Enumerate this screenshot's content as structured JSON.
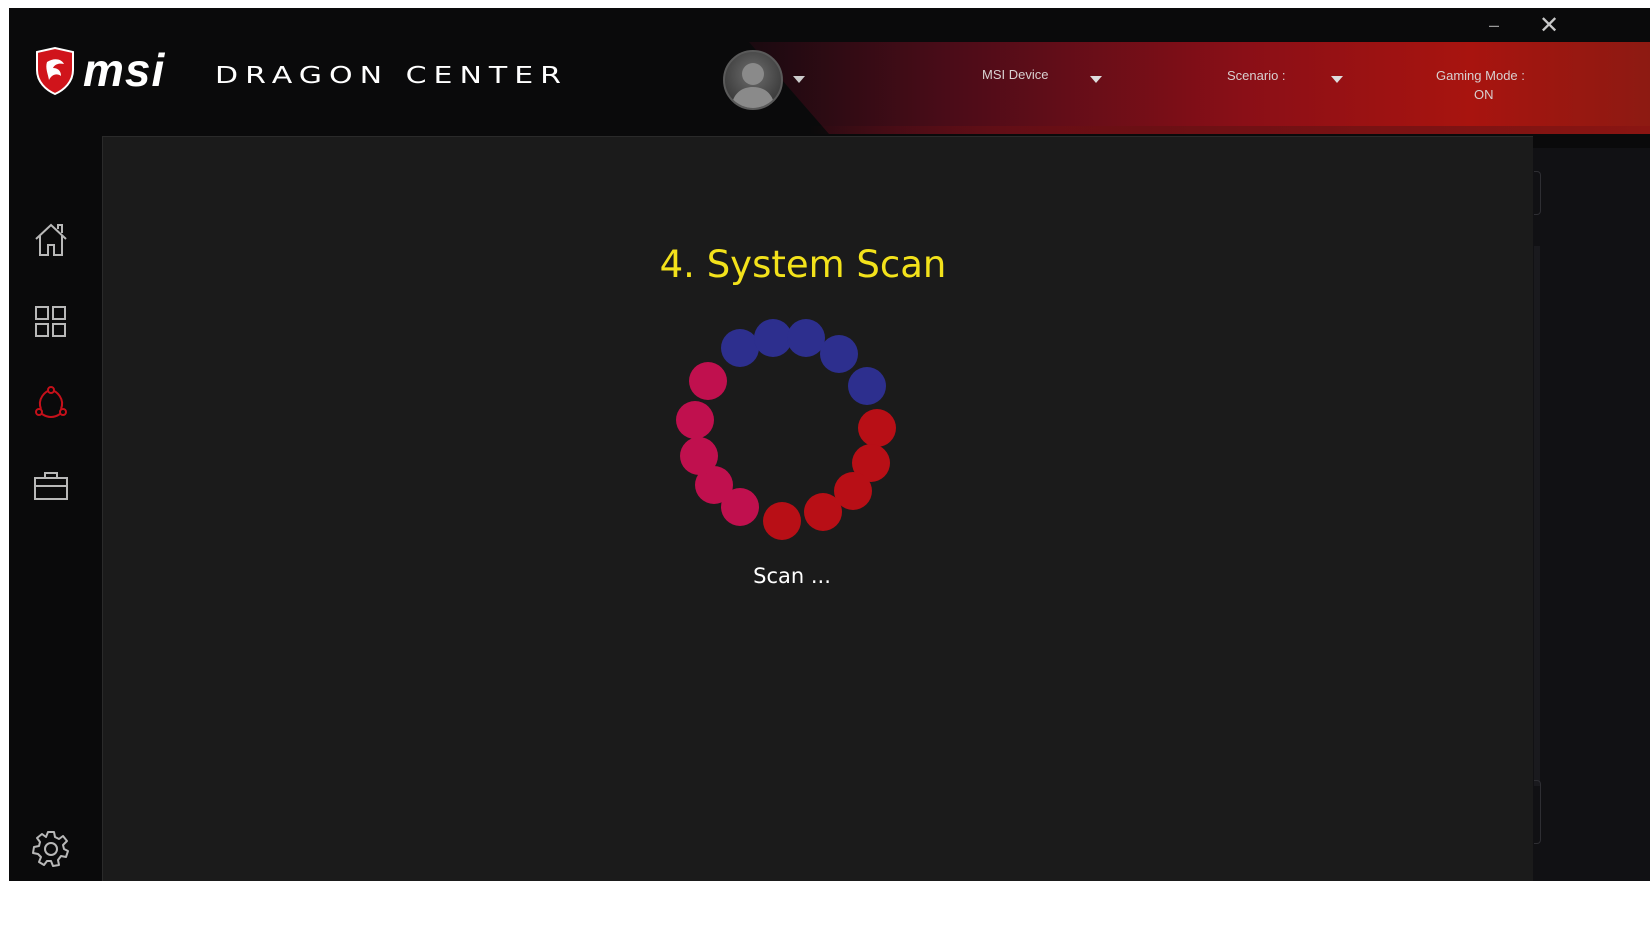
{
  "header": {
    "brand_msi": "msi",
    "brand_dragon_center": "DRAGON CENTER",
    "msi_device_label": "MSI Device",
    "scenario_label": "Scenario :",
    "gaming_mode_label": "Gaming Mode :",
    "gaming_mode_value": "ON",
    "minimize_glyph": "–",
    "close_glyph": "✕"
  },
  "sidebar": {
    "items": [
      {
        "icon": "home-icon",
        "active": false
      },
      {
        "icon": "apps-grid-icon",
        "active": false
      },
      {
        "icon": "network-icon",
        "active": true
      },
      {
        "icon": "toolbox-icon",
        "active": false
      }
    ],
    "settings_icon": "gear-icon"
  },
  "main": {
    "title": "4. System Scan",
    "status": "Scan ..."
  },
  "colors": {
    "title": "#f3e21b",
    "accent_red": "#c5101a",
    "spinner_blue": "#2d2f8e",
    "spinner_red": "#b80f16",
    "spinner_pink": "#c0104e",
    "panel_bg": "#1b1b1b"
  }
}
